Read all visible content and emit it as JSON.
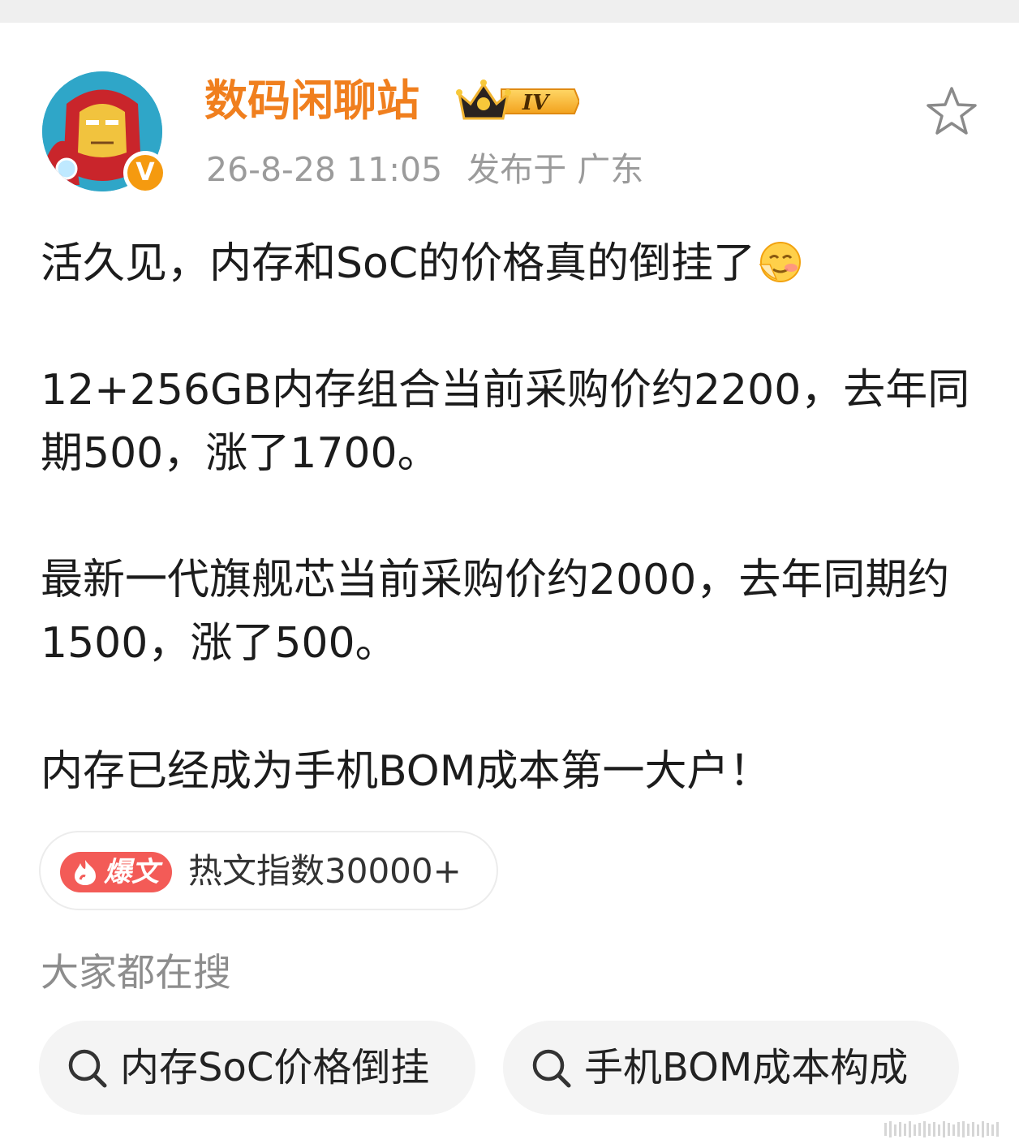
{
  "author": {
    "name": "数码闲聊站",
    "level_badge": "IV",
    "verified_badge": "V",
    "avatar_icon": "iron-man-avatar"
  },
  "post_meta": {
    "time": "26-8-28 11:05",
    "location": "发布于 广东"
  },
  "post": {
    "line1": "活久见，内存和SoC的价格真的倒挂了",
    "emoji": "facepalm-emoji",
    "para2": "12+256GB内存组合当前采购价约2200，去年同期500，涨了1700。",
    "para3": "最新一代旗舰芯当前采购价约2000，去年同期约1500，涨了500。",
    "para4": "内存已经成为手机BOM成本第一大户！"
  },
  "hot": {
    "badge_label": "爆文",
    "index_text": "热文指数30000+"
  },
  "search": {
    "title": "大家都在搜",
    "chips": [
      {
        "label": "内存SoC价格倒挂",
        "icon": "search-icon"
      },
      {
        "label": "手机BOM成本构成",
        "icon": "search-icon"
      }
    ]
  },
  "colors": {
    "username": "#f07f1e",
    "hot_badge": "#f35b57",
    "meta": "#9b9b9b"
  }
}
